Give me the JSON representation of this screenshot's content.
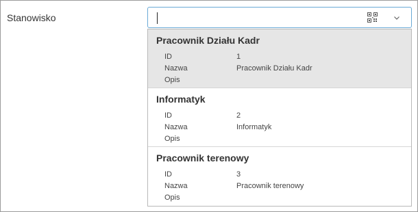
{
  "field": {
    "label": "Stanowisko",
    "value": ""
  },
  "icons": {
    "qr": "qr-code-icon",
    "chevron": "chevron-down-icon"
  },
  "options": [
    {
      "title": "Pracownik Działu Kadr",
      "id_label": "ID",
      "id_value": "1",
      "name_label": "Nazwa",
      "name_value": "Pracownik Działu Kadr",
      "desc_label": "Opis",
      "desc_value": ""
    },
    {
      "title": "Informatyk",
      "id_label": "ID",
      "id_value": "2",
      "name_label": "Nazwa",
      "name_value": "Informatyk",
      "desc_label": "Opis",
      "desc_value": ""
    },
    {
      "title": "Pracownik terenowy",
      "id_label": "ID",
      "id_value": "3",
      "name_label": "Nazwa",
      "name_value": "Pracownik terenowy",
      "desc_label": "Opis",
      "desc_value": ""
    }
  ]
}
